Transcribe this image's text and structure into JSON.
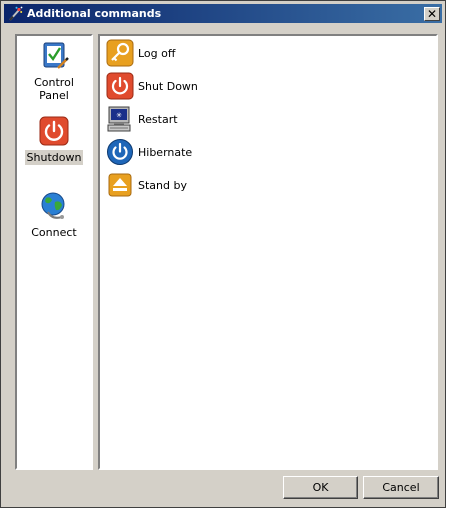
{
  "window": {
    "title": "Additional commands",
    "close_glyph": "✕"
  },
  "sidebar": {
    "items": [
      {
        "label": "Control Panel",
        "icon": "control-panel-icon",
        "selected": false
      },
      {
        "label": "Shutdown",
        "icon": "shutdown-icon",
        "selected": true
      },
      {
        "label": "Connect",
        "icon": "globe-icon",
        "selected": false
      }
    ]
  },
  "commands": [
    {
      "label": "Log off",
      "icon": "key-icon"
    },
    {
      "label": "Shut Down",
      "icon": "power-icon"
    },
    {
      "label": "Restart",
      "icon": "computer-icon"
    },
    {
      "label": "Hibernate",
      "icon": "hibernate-icon"
    },
    {
      "label": "Stand by",
      "icon": "eject-icon"
    }
  ],
  "buttons": {
    "ok_label": "OK",
    "cancel_label": "Cancel"
  },
  "colors": {
    "title_bar_start": "#0a246a",
    "title_bar_end": "#3a6ea5",
    "dialog_face": "#d4d0c8",
    "power_red": "#e04b2e",
    "key_orange": "#e8a020",
    "hibernate_blue": "#1e66b8"
  }
}
